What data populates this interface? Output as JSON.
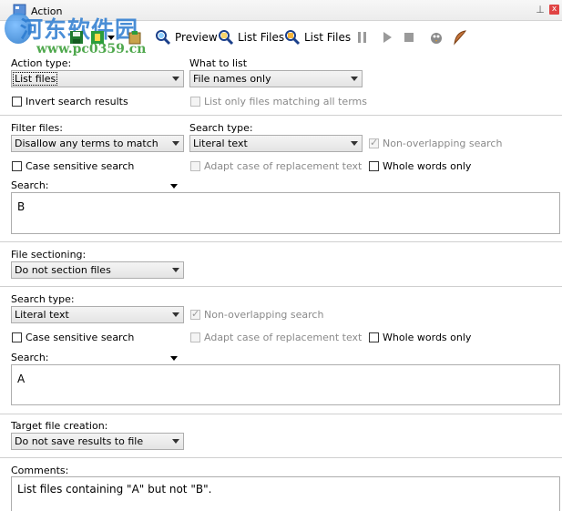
{
  "window": {
    "title": "Action",
    "pin_glyph": "⊥",
    "close_glyph": "x"
  },
  "watermark": {
    "text": "河东软件园",
    "url": "www.pc0359.cn"
  },
  "toolbar": {
    "preview_label": "Preview",
    "list_files_label": "List Files",
    "list_files2_label": "List Files",
    "icons": [
      "save-icon",
      "save-green-icon",
      "dropdown-icon",
      "clipboard-icon",
      "preview-icon",
      "list-files-icon",
      "list-files2-icon",
      "pause-icon",
      "play-icon",
      "stop-icon",
      "bird-icon",
      "feather-icon"
    ]
  },
  "action_type": {
    "label": "Action type:",
    "value": "List files"
  },
  "what_to_list": {
    "label": "What to list",
    "value": "File names only"
  },
  "invert_results": {
    "label": "Invert search results",
    "checked": false
  },
  "list_only_matching": {
    "label": "List only files matching all terms",
    "checked": false,
    "enabled": false
  },
  "filter_files": {
    "label": "Filter files:",
    "value": "Disallow any terms to match"
  },
  "search_type_1": {
    "label": "Search type:",
    "value": "Literal text"
  },
  "non_overlap_1": {
    "label": "Non-overlapping search",
    "checked": true,
    "enabled": false
  },
  "case_sensitive_1": {
    "label": "Case sensitive search",
    "checked": false
  },
  "adapt_case_1": {
    "label": "Adapt case of replacement text",
    "checked": false,
    "enabled": false
  },
  "whole_words_1": {
    "label": "Whole words only",
    "checked": false
  },
  "search_1": {
    "label": "Search:",
    "value": "B"
  },
  "file_sectioning": {
    "label": "File sectioning:",
    "value": "Do not section files"
  },
  "search_type_2": {
    "label": "Search type:",
    "value": "Literal text"
  },
  "non_overlap_2": {
    "label": "Non-overlapping search",
    "checked": true,
    "enabled": false
  },
  "case_sensitive_2": {
    "label": "Case sensitive search",
    "checked": false
  },
  "adapt_case_2": {
    "label": "Adapt case of replacement text",
    "checked": false,
    "enabled": false
  },
  "whole_words_2": {
    "label": "Whole words only",
    "checked": false
  },
  "search_2": {
    "label": "Search:",
    "value": "A"
  },
  "target_file": {
    "label": "Target file creation:",
    "value": "Do not save results to file"
  },
  "comments": {
    "label": "Comments:",
    "value": "List files containing \"A\" but not \"B\"."
  }
}
